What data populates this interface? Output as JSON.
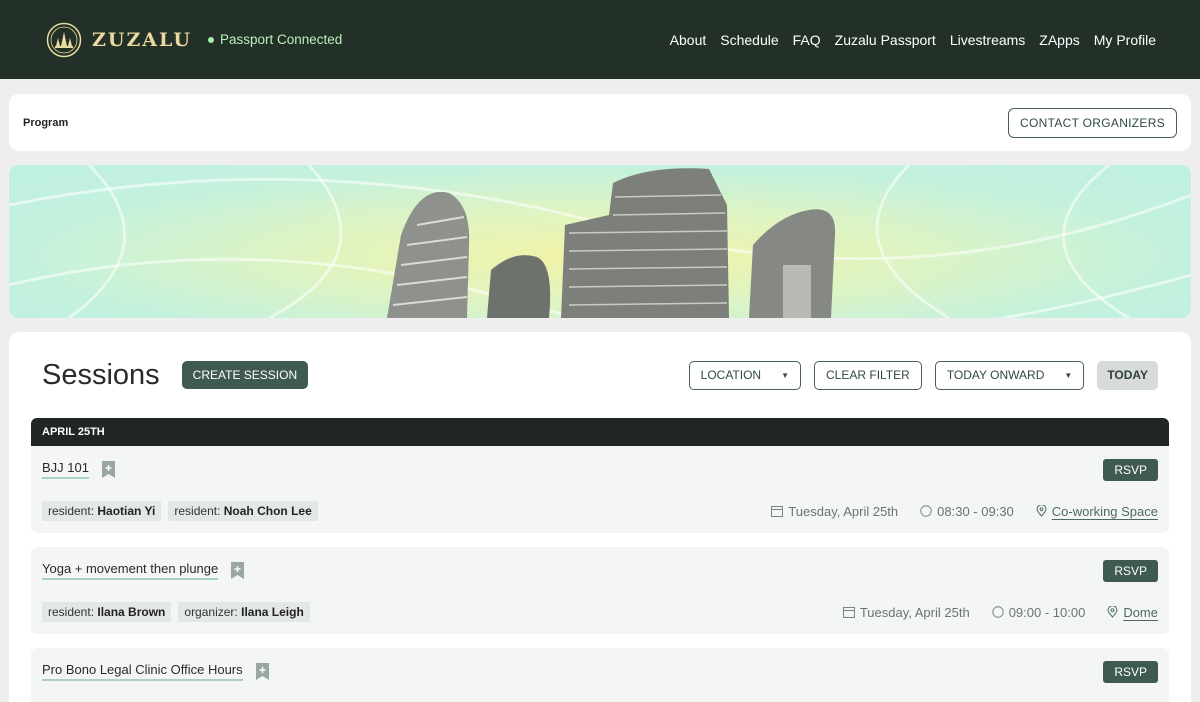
{
  "header": {
    "brand": "ZUZALU",
    "passport_status": "Passport Connected",
    "nav": [
      "About",
      "Schedule",
      "FAQ",
      "Zuzalu Passport",
      "Livestreams",
      "ZApps",
      "My Profile"
    ]
  },
  "program_bar": {
    "label": "Program",
    "contact_button": "CONTACT ORGANIZERS"
  },
  "sessions": {
    "title": "Sessions",
    "create_button": "CREATE SESSION",
    "filters": {
      "location": "LOCATION",
      "clear": "CLEAR FILTER",
      "range": "TODAY ONWARD",
      "today": "TODAY"
    },
    "day_label": "APRIL 25TH",
    "items": [
      {
        "title": "BJJ 101",
        "rsvp": "RSVP",
        "tags": [
          {
            "role": "resident:",
            "name": "Haotian Yi"
          },
          {
            "role": "resident:",
            "name": "Noah Chon Lee"
          }
        ],
        "date": "Tuesday, April 25th",
        "time": "08:30 - 09:30",
        "location": "Co-working Space"
      },
      {
        "title": "Yoga + movement then plunge",
        "rsvp": "RSVP",
        "tags": [
          {
            "role": "resident:",
            "name": "Ilana Brown"
          },
          {
            "role": "organizer:",
            "name": "Ilana Leigh"
          }
        ],
        "date": "Tuesday, April 25th",
        "time": "09:00 - 10:00",
        "location": "Dome"
      },
      {
        "title": "Pro Bono Legal Clinic Office Hours",
        "rsvp": "RSVP"
      }
    ]
  },
  "colors": {
    "header_bg": "#233028",
    "accent": "#3f5a52",
    "brand_gold": "#ead9a0"
  }
}
